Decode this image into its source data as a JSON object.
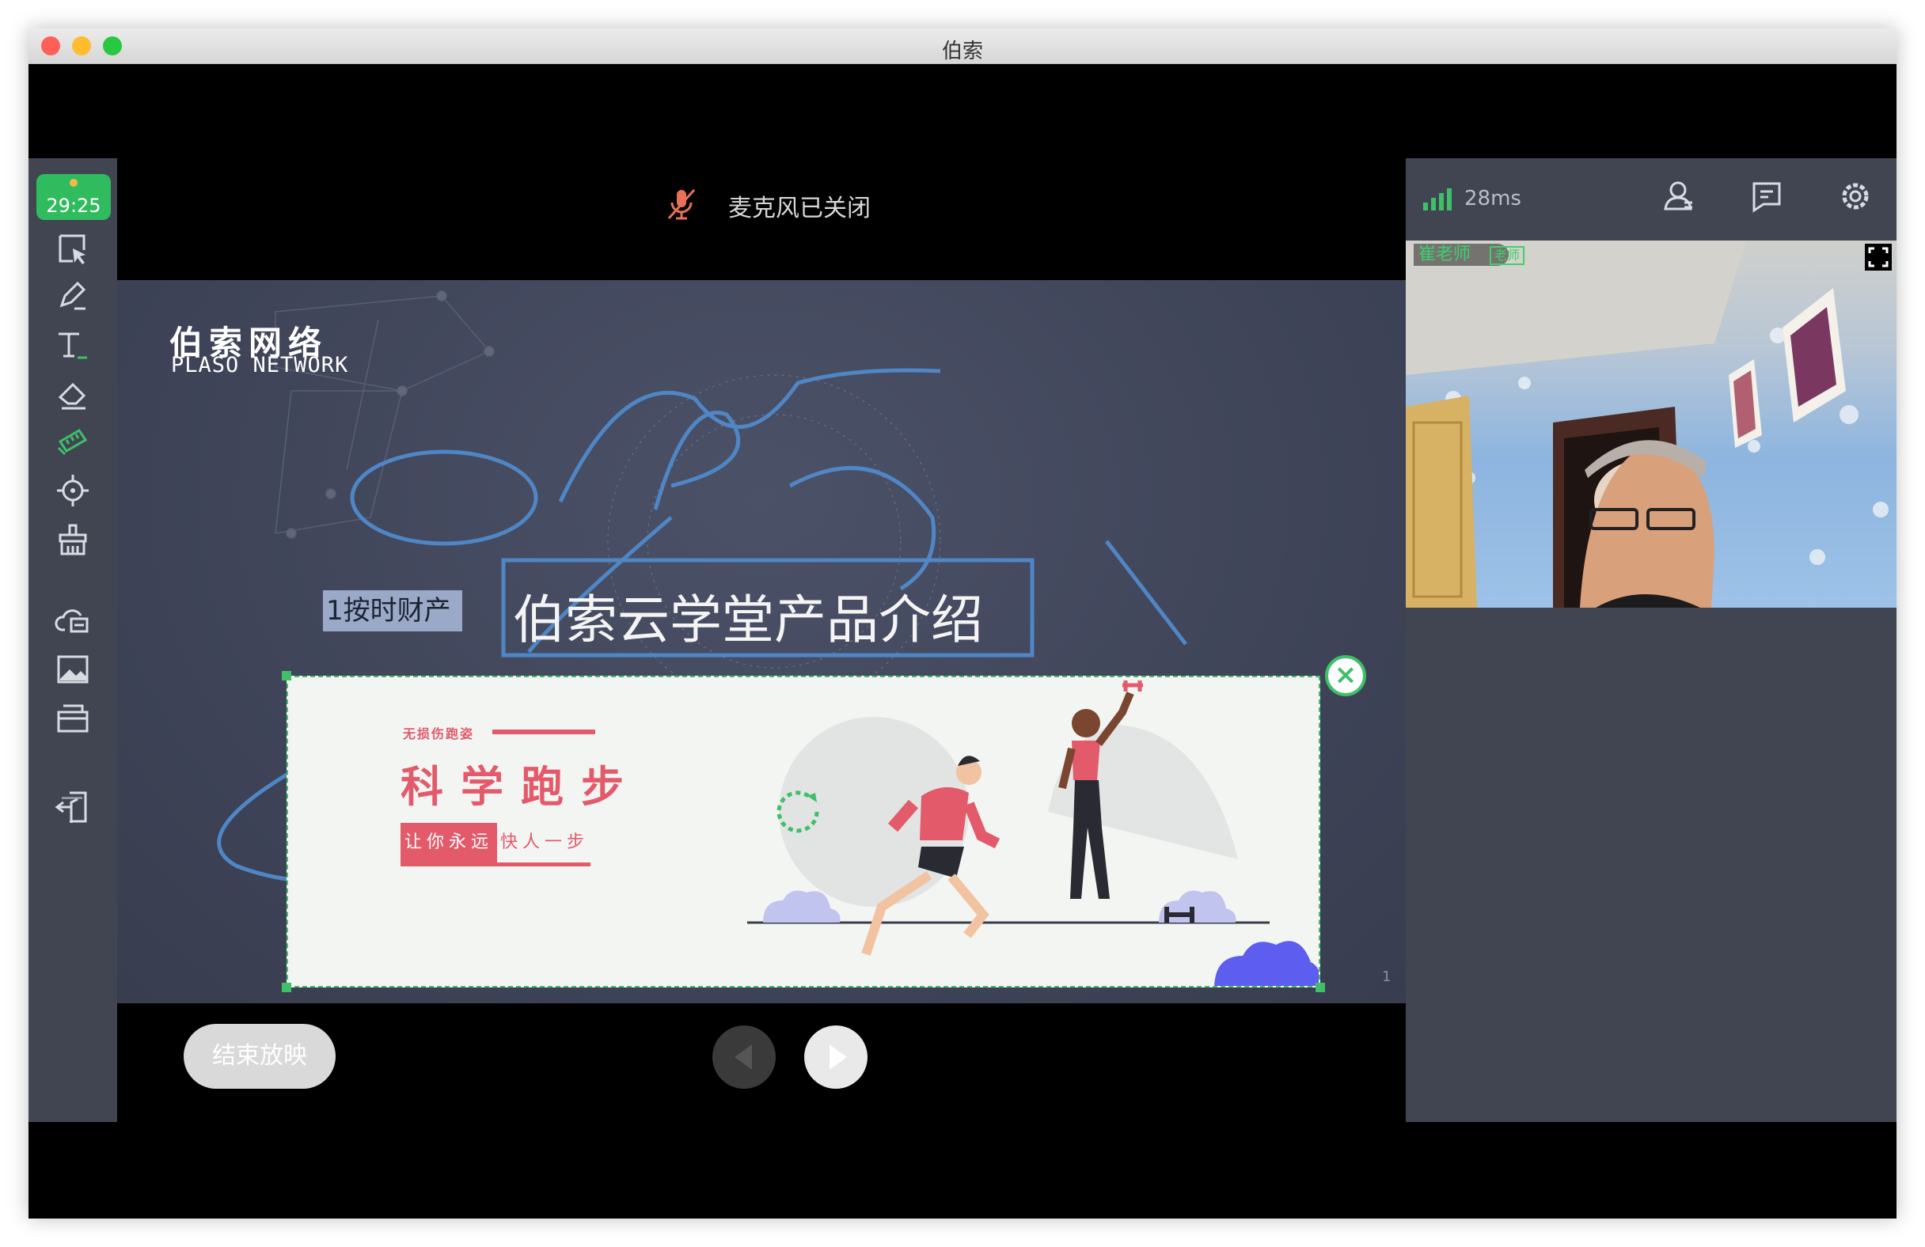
{
  "window": {
    "title": "伯索"
  },
  "timer": {
    "value": "29:25"
  },
  "sidebar": {
    "tools": [
      {
        "name": "select-tool",
        "icon": "cursor-select-icon"
      },
      {
        "name": "pen-tool",
        "icon": "pencil-icon"
      },
      {
        "name": "text-tool",
        "icon": "text-icon"
      },
      {
        "name": "eraser-tool",
        "icon": "eraser-icon"
      },
      {
        "name": "laser-tool",
        "icon": "ruler-icon",
        "active": true
      },
      {
        "name": "pointer-tool",
        "icon": "target-icon"
      },
      {
        "name": "clear-tool",
        "icon": "broom-icon"
      },
      {
        "name": "cloud-tool",
        "icon": "cloud-disk-icon"
      },
      {
        "name": "image-tool",
        "icon": "image-icon"
      },
      {
        "name": "box-tool",
        "icon": "toolbox-icon"
      },
      {
        "name": "exit-tool",
        "icon": "exit-icon"
      }
    ]
  },
  "mic": {
    "status": "麦克风已关闭"
  },
  "slide": {
    "brand_cn": "伯索网络",
    "brand_en": "PLASO NETWORK",
    "tag": "1按时财产",
    "title": "伯索云学堂产品介绍",
    "page": "1"
  },
  "banner": {
    "small": "无损伤跑姿",
    "big": "科学跑步",
    "line_a": "让你永远",
    "line_b": "快人一步"
  },
  "controls": {
    "end": "结束放映"
  },
  "panel": {
    "ping": "28ms"
  },
  "video": {
    "name": "崔老师",
    "role": "老师"
  },
  "colors": {
    "accent": "#3fbf68",
    "banner_red": "#e35a6a",
    "mic_off": "#e8705a"
  }
}
